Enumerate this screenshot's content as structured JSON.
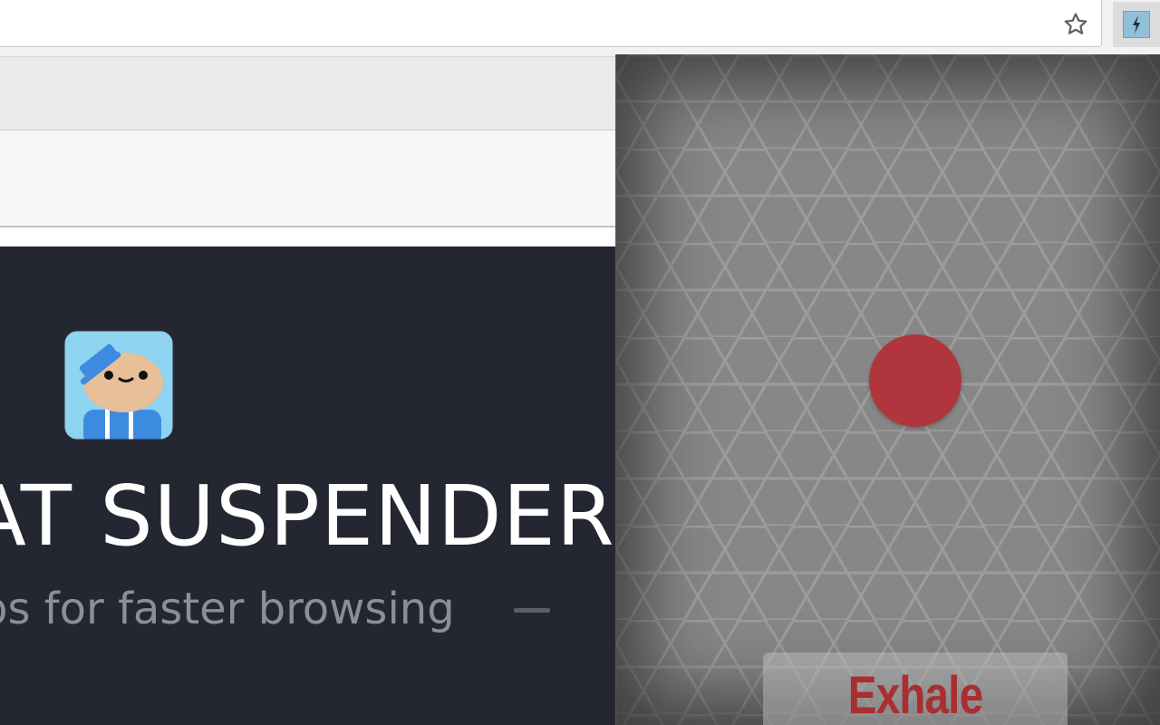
{
  "toolbar": {
    "bookmark_icon": "star-outline-icon",
    "extension_icon": "lightning-bolt-icon",
    "extension_icon_color": "#8fbfd9"
  },
  "page": {
    "logo_icon": "suspender-mascot-icon",
    "hero_title": "AT SUSPENDER",
    "hero_subtitle": "bs for faster browsing",
    "hero_background": "#242732"
  },
  "popup": {
    "dot_color": "#b0353d",
    "phase_label": "Exhale",
    "phase_color": "#a82e30"
  }
}
